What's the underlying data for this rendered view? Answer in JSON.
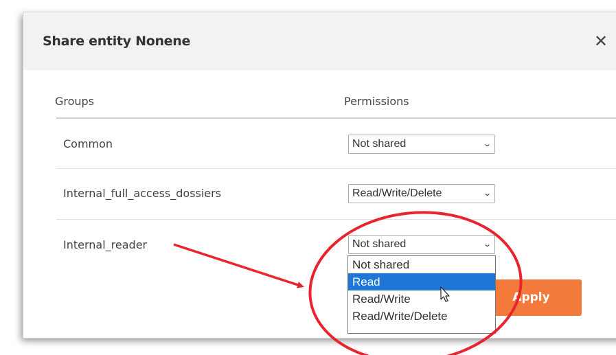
{
  "dialog": {
    "title": "Share entity Nonene",
    "close_glyph": "✕"
  },
  "table": {
    "headers": {
      "groups": "Groups",
      "permissions": "Permissions"
    },
    "rows": [
      {
        "group": "Common",
        "permission": "Not shared"
      },
      {
        "group": "Internal_full_access_dossiers",
        "permission": "Read/Write/Delete"
      },
      {
        "group": "Internal_reader",
        "permission": "Not shared"
      }
    ]
  },
  "dropdown": {
    "options": [
      "Not shared",
      "Read",
      "Read/Write",
      "Read/Write/Delete"
    ],
    "highlighted": "Read"
  },
  "apply_label": "Apply",
  "select_chevron": "⌄",
  "colors": {
    "accent": "#f47a3b",
    "selection": "#1e76d6",
    "annotation": "#e8242d",
    "header_bg": "#f2f2f2"
  },
  "icons": {
    "close": "close-icon",
    "chevron": "chevron-down-icon",
    "cursor": "mouse-cursor-icon"
  }
}
